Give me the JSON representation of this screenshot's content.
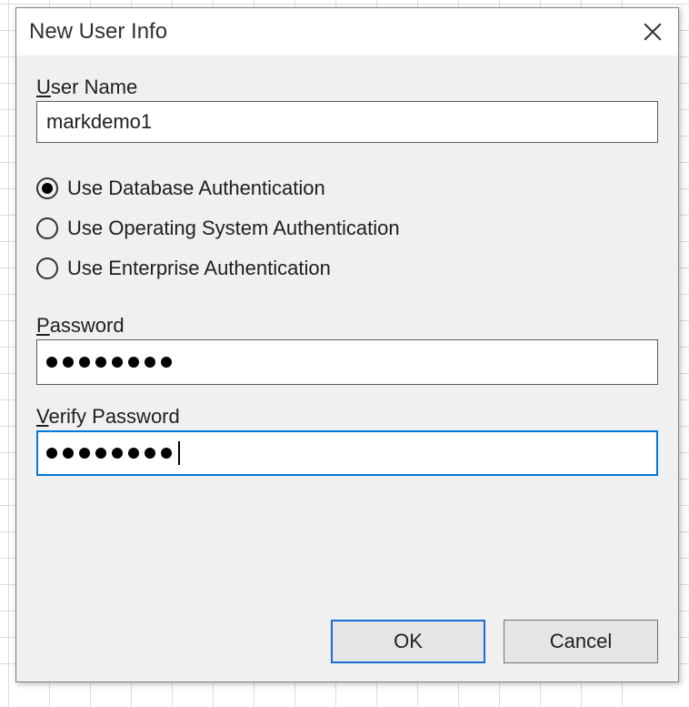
{
  "dialog": {
    "title": "New User Info"
  },
  "labels": {
    "user_name_u": "U",
    "user_name_rest": "ser Name",
    "password_u": "P",
    "password_rest": "assword",
    "verify_u": "V",
    "verify_rest": "erify Password"
  },
  "fields": {
    "user_name_value": "markdemo1",
    "password_mask": "••••••••",
    "verify_mask": "••••••••"
  },
  "auth_options": {
    "db": "Use Database Authentication",
    "os": "Use Operating System Authentication",
    "ent": "Use Enterprise Authentication",
    "selected": "db"
  },
  "buttons": {
    "ok": "OK",
    "cancel": "Cancel"
  }
}
